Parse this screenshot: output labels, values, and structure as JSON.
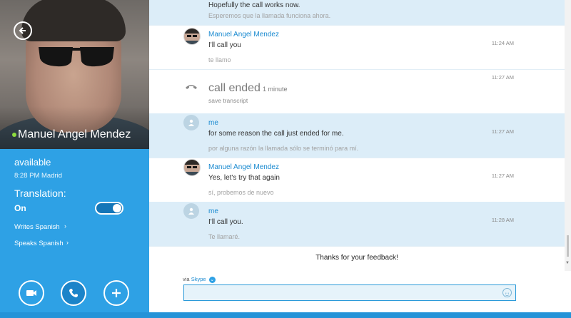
{
  "contact": {
    "name": "Manuel Angel Mendez",
    "status": "available",
    "local_time": "8:28 PM Madrid"
  },
  "translation": {
    "label": "Translation:",
    "state": "On",
    "writes": "Writes Spanish",
    "speaks": "Speaks Spanish"
  },
  "messages": [
    {
      "sender": "",
      "text": "Hopefully the call works now.",
      "translated": "Esperemos que la llamada funciona ahora.",
      "time": ""
    },
    {
      "sender": "Manuel Angel Mendez",
      "text": "I'll call you",
      "translated": "te llamo",
      "time": "11:24 AM"
    },
    {
      "sender": "me",
      "text": "for some reason the call just ended for me.",
      "translated": "por alguna razón la llamada sólo se terminó para mí.",
      "time": "11:27 AM"
    },
    {
      "sender": "Manuel Angel Mendez",
      "text": "Yes, let's try that again",
      "translated": "sí, probemos de nuevo",
      "time": "11:27 AM"
    },
    {
      "sender": "me",
      "text": "I'll call you.",
      "translated": "Te llamaré.",
      "time": "11:28 AM"
    }
  ],
  "call_event": {
    "label": "call ended",
    "duration": "1 minute",
    "save_transcript": "save transcript",
    "time": "11:27 AM"
  },
  "feedback": "Thanks for your feedback!",
  "composer": {
    "via": "via",
    "service": "Skype"
  },
  "icons": {
    "back": "back-arrow-icon",
    "video": "video-camera-icon",
    "call": "phone-icon",
    "add": "plus-icon",
    "call_ended": "phone-hangup-icon",
    "emoji": "smiley-icon",
    "user": "user-silhouette-icon"
  },
  "colors": {
    "accent": "#2ea1e5",
    "online": "#8ddc3e",
    "link": "#1a8ad0",
    "my_message_bg": "#dcedf8"
  }
}
